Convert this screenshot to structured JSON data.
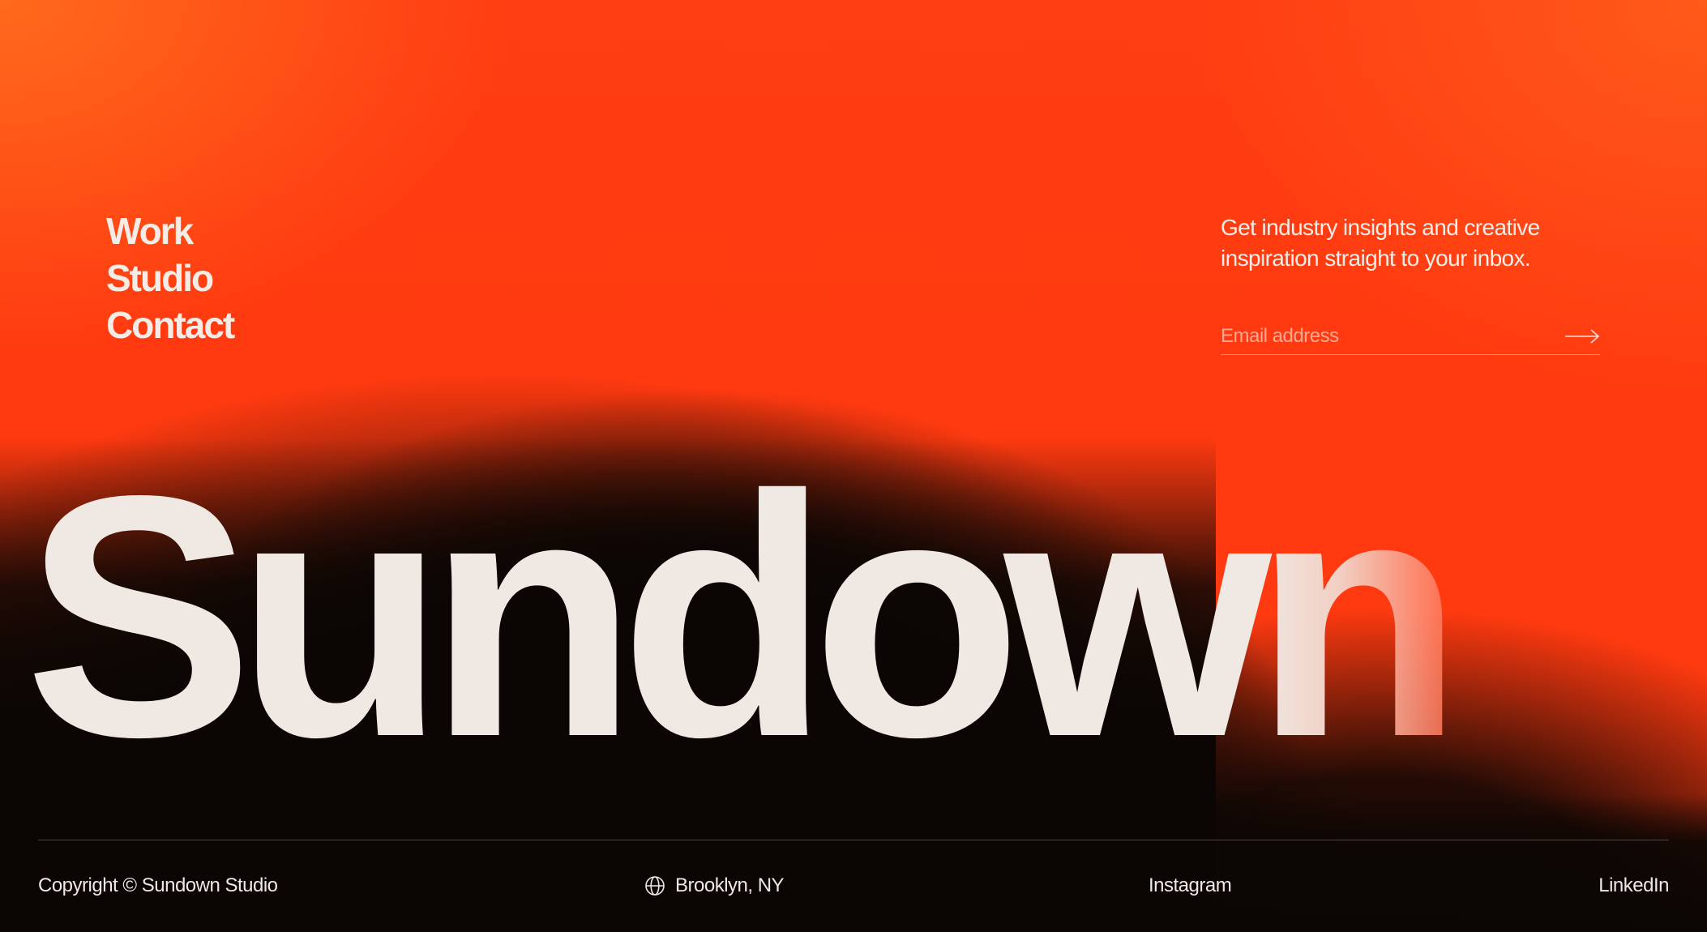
{
  "nav": {
    "items": [
      {
        "label": "Work"
      },
      {
        "label": "Studio"
      },
      {
        "label": "Contact"
      }
    ]
  },
  "newsletter": {
    "text_line1": "Get industry insights and creative",
    "text_line2": "inspiration straight to your inbox.",
    "email_value": "",
    "email_placeholder": "Email address",
    "submit_icon": "arrow-right-icon"
  },
  "hero": {
    "wordmark_main": "Sundow",
    "wordmark_tail": "n"
  },
  "footer": {
    "copyright": "Copyright © Sundown Studio",
    "location_icon": "globe-icon",
    "location": "Brooklyn, NY",
    "instagram": "Instagram",
    "linkedin": "LinkedIn"
  },
  "colors": {
    "accent_orange": "#ff3a10",
    "dark_background": "#0b0604",
    "text_light": "#efe8e3"
  }
}
